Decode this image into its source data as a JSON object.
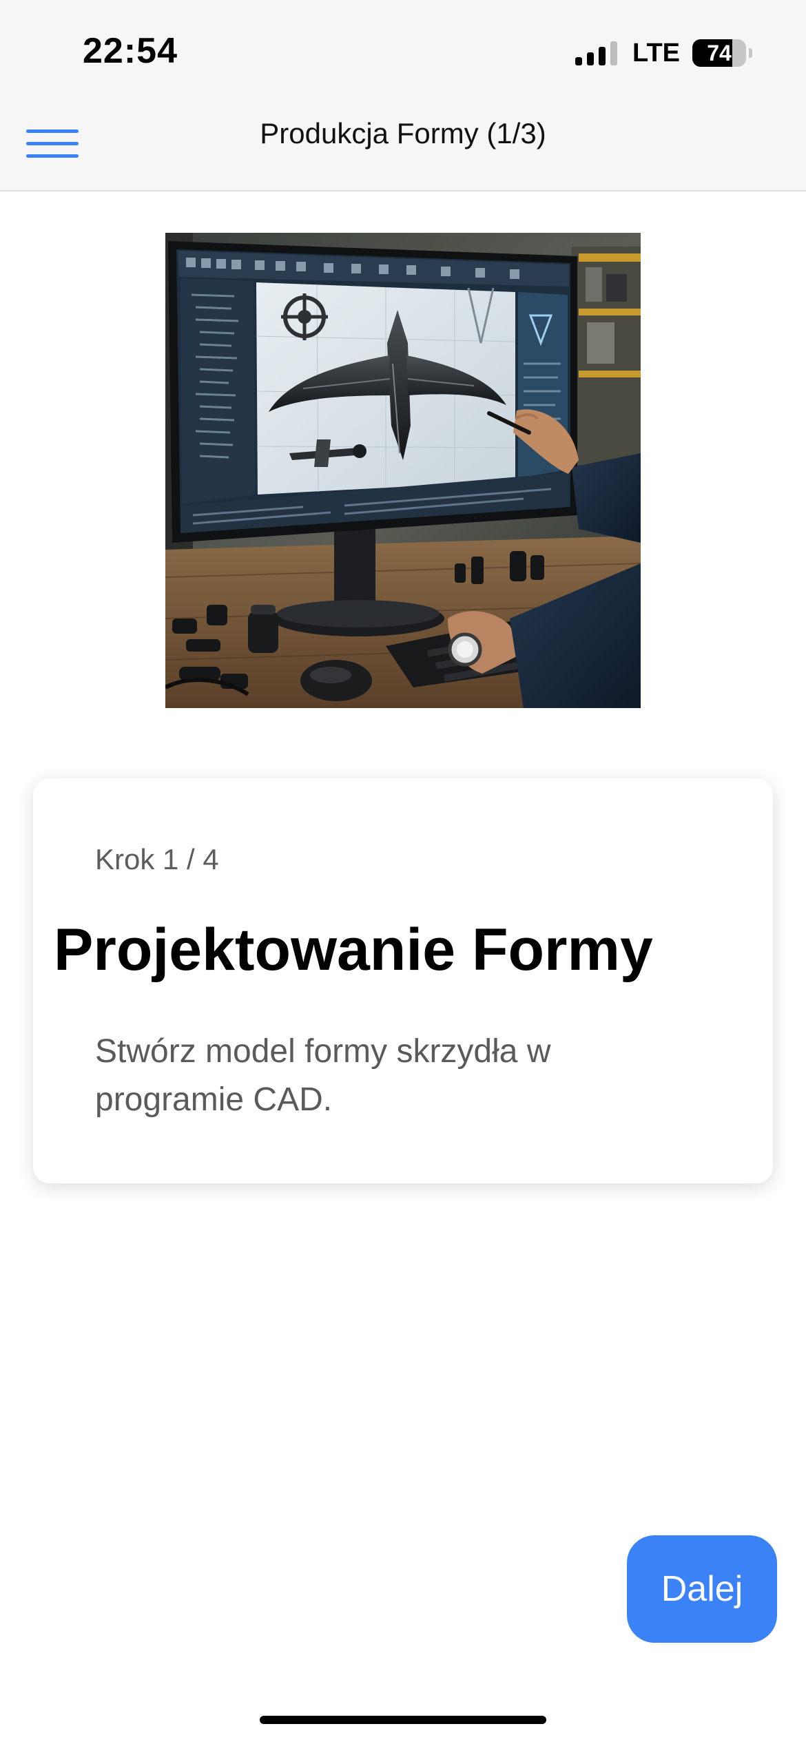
{
  "status_bar": {
    "time": "22:54",
    "network": "LTE",
    "battery": "74",
    "battery_level": 0.74,
    "signal_bars": 3
  },
  "header": {
    "title": "Produkcja Formy (1/3)",
    "menu_icon": "hamburger-menu-icon",
    "accent_color": "#3b82f6"
  },
  "hero_image": {
    "subject": "cad-workstation-illustration"
  },
  "step_card": {
    "step": "Krok 1 / 4",
    "title": "Projektowanie Formy",
    "description": "Stwórz model formy skrzydła w programie CAD."
  },
  "actions": {
    "next_label": "Dalej"
  }
}
